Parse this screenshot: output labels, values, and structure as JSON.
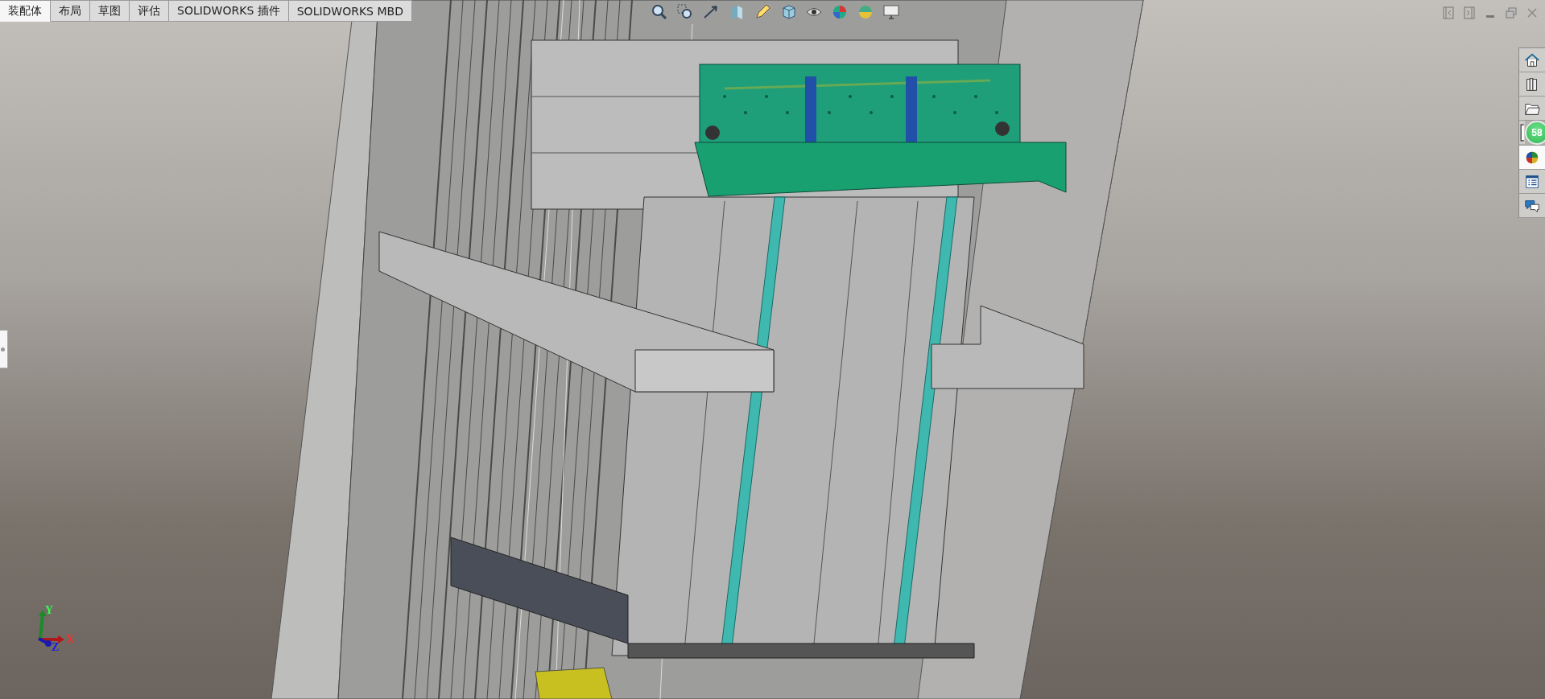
{
  "tabs": [
    {
      "label": "装配体",
      "selected": true
    },
    {
      "label": "布局",
      "selected": false
    },
    {
      "label": "草图",
      "selected": false
    },
    {
      "label": "评估",
      "selected": false
    },
    {
      "label": "SOLIDWORKS 插件",
      "selected": false
    },
    {
      "label": "SOLIDWORKS MBD",
      "selected": false
    }
  ],
  "task_pane": [
    {
      "kind": "home",
      "selected": false
    },
    {
      "kind": "library",
      "selected": false
    },
    {
      "kind": "folder",
      "selected": false
    },
    {
      "kind": "file",
      "selected": false,
      "badge": "58"
    },
    {
      "kind": "appearance",
      "selected": true
    },
    {
      "kind": "properties",
      "selected": false
    },
    {
      "kind": "forum",
      "selected": false
    }
  ],
  "triad": {
    "x_label": "X",
    "y_label": "Y",
    "z_label": "Z"
  }
}
